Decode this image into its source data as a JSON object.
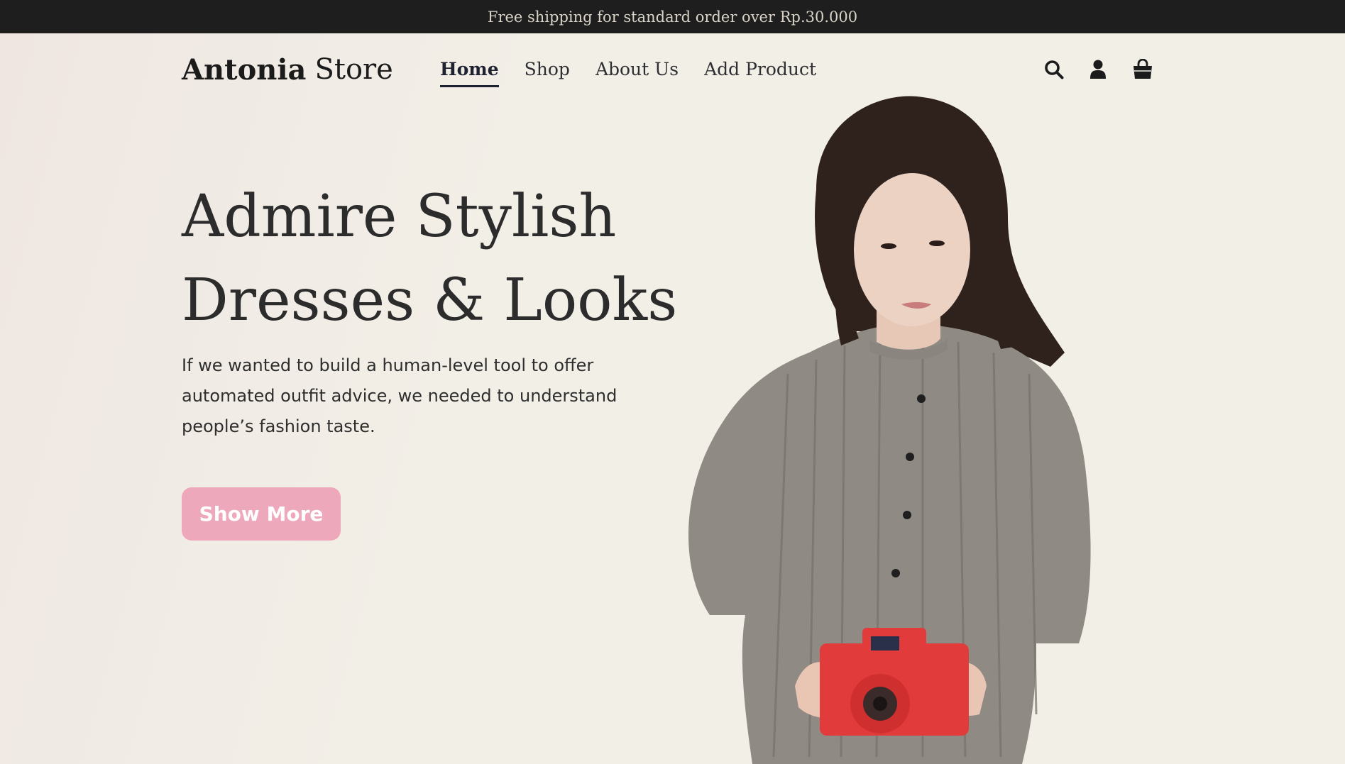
{
  "announcement": "Free shipping for standard order over Rp.30.000",
  "header": {
    "logo_bold": "Antonia",
    "logo_light": "Store",
    "nav": [
      {
        "label": "Home",
        "active": true
      },
      {
        "label": "Shop",
        "active": false
      },
      {
        "label": "About Us",
        "active": false
      },
      {
        "label": "Add Product",
        "active": false
      }
    ],
    "icons": [
      "search-icon",
      "user-icon",
      "shopping-bag-icon"
    ]
  },
  "hero": {
    "headline_line1": "Admire Stylish",
    "headline_line2": "Dresses & Looks",
    "description": "If we wanted to build a human-level tool to offer automated outfit advice, we needed to understand people’s fashion taste.",
    "cta_label": "Show More",
    "image": "woman in grey striped dress holding red camera"
  },
  "colors": {
    "announcement_bg": "#1e1e1e",
    "page_bg": "#f2efe7",
    "cta_bg": "#eea8bb",
    "text": "#2c2c2c"
  }
}
